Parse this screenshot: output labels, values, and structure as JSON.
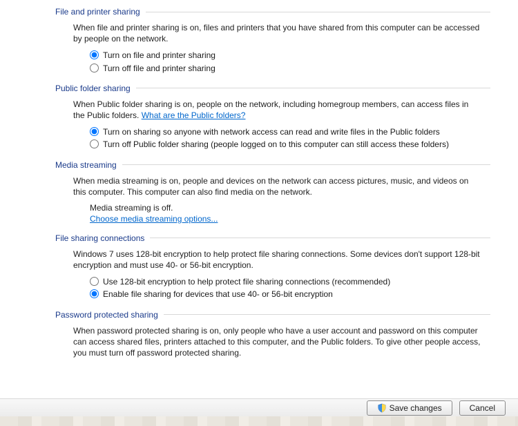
{
  "sections": {
    "fileprinter": {
      "title": "File and printer sharing",
      "desc": "When file and printer sharing is on, files and printers that you have shared from this computer can be accessed by people on the network.",
      "opt_on": "Turn on file and printer sharing",
      "opt_off": "Turn off file and printer sharing"
    },
    "publicfolder": {
      "title": "Public folder sharing",
      "desc_a": "When Public folder sharing is on, people on the network, including homegroup members, can access files in the Public folders. ",
      "desc_link": "What are the Public folders?",
      "opt_on": "Turn on sharing so anyone with network access can read and write files in the Public folders",
      "opt_off": "Turn off Public folder sharing (people logged on to this computer can still access these folders)"
    },
    "media": {
      "title": "Media streaming",
      "desc": "When media streaming is on, people and devices on the network can access pictures, music, and videos on this computer. This computer can also find media on the network.",
      "status": "Media streaming is off.",
      "link": "Choose media streaming options..."
    },
    "fsc": {
      "title": "File sharing connections",
      "desc": "Windows 7 uses 128-bit encryption to help protect file sharing connections. Some devices don't support 128-bit encryption and must use 40- or 56-bit encryption.",
      "opt_128": "Use 128-bit encryption to help protect file sharing connections (recommended)",
      "opt_4056": "Enable file sharing for devices that use 40- or 56-bit encryption"
    },
    "pps": {
      "title": "Password protected sharing",
      "desc": "When password protected sharing is on, only people who have a user account and password on this computer can access shared files, printers attached to this computer, and the Public folders. To give other people access, you must turn off password protected sharing."
    }
  },
  "buttons": {
    "save": "Save changes",
    "cancel": "Cancel"
  }
}
